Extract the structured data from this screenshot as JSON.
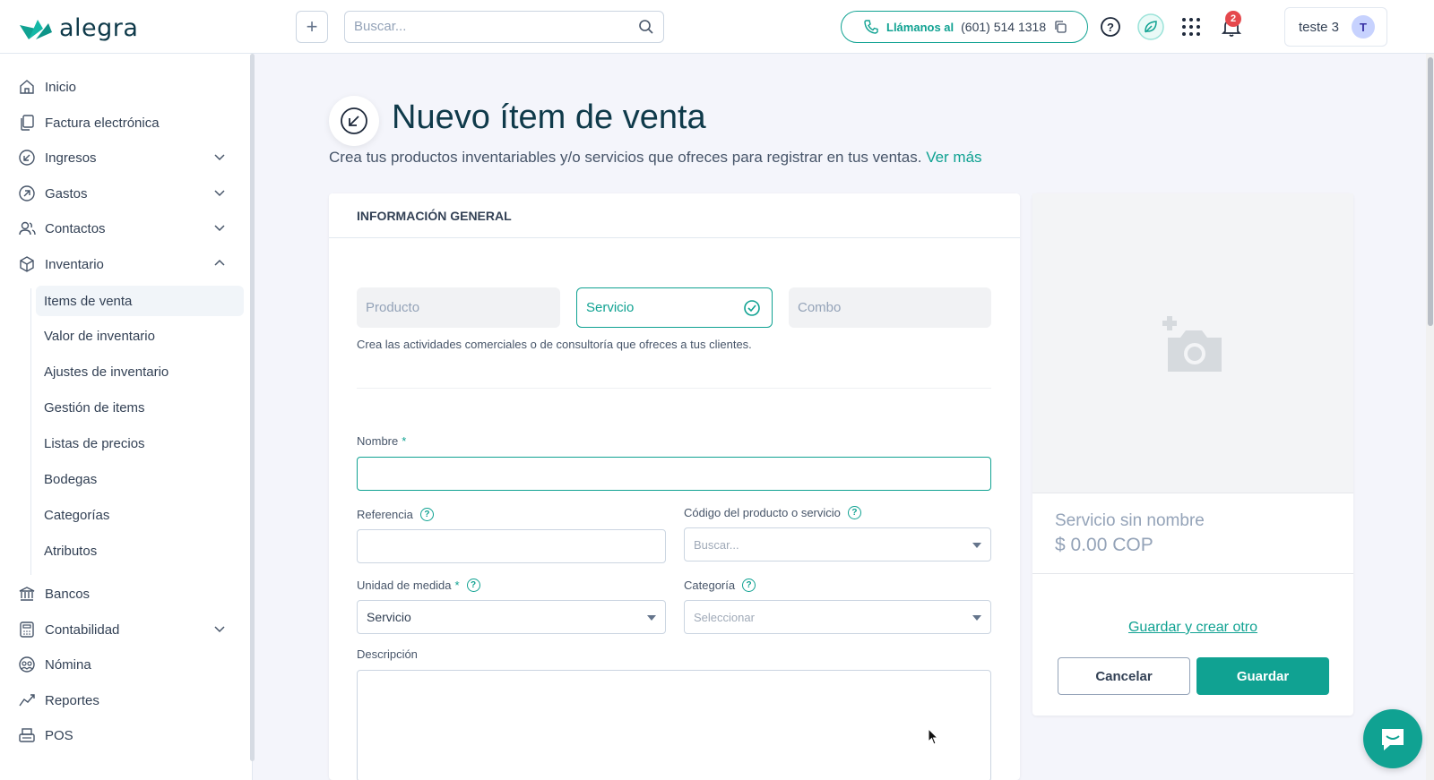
{
  "header": {
    "brand": "alegra",
    "add_label": "+",
    "search_placeholder": "Buscar...",
    "call_label": "Llámanos al",
    "call_number": "(601) 514 1318",
    "notification_count": "2",
    "user_name": "teste 3",
    "user_initial": "T"
  },
  "sidebar": {
    "items": [
      {
        "label": "Inicio"
      },
      {
        "label": "Factura electrónica"
      },
      {
        "label": "Ingresos"
      },
      {
        "label": "Gastos"
      },
      {
        "label": "Contactos"
      },
      {
        "label": "Inventario"
      },
      {
        "label": "Bancos"
      },
      {
        "label": "Contabilidad"
      },
      {
        "label": "Nómina"
      },
      {
        "label": "Reportes"
      },
      {
        "label": "POS"
      }
    ],
    "inventory_sub": [
      {
        "label": "Items de venta"
      },
      {
        "label": "Valor de inventario"
      },
      {
        "label": "Ajustes de inventario"
      },
      {
        "label": "Gestión de items"
      },
      {
        "label": "Listas de precios"
      },
      {
        "label": "Bodegas"
      },
      {
        "label": "Categorías"
      },
      {
        "label": "Atributos"
      }
    ]
  },
  "page": {
    "title": "Nuevo ítem de venta",
    "subtitle": "Crea tus productos inventariables y/o servicios que ofreces para registrar en tus ventas.",
    "subtitle_link": "Ver más"
  },
  "form": {
    "section_title": "INFORMACIÓN GENERAL",
    "types": [
      "Producto",
      "Servicio",
      "Combo"
    ],
    "selected_type": "Servicio",
    "type_help": "Crea las actividades comerciales o de consultoría que ofreces a tus clientes.",
    "name_label": "Nombre",
    "required_mark": "*",
    "name_value": "",
    "reference_label": "Referencia",
    "reference_value": "",
    "code_label": "Código del producto o servicio",
    "code_placeholder": "Buscar...",
    "unit_label": "Unidad de medida",
    "unit_value": "Servicio",
    "category_label": "Categoría",
    "category_placeholder": "Seleccionar",
    "description_label": "Descripción",
    "help_glyph": "?"
  },
  "preview": {
    "name": "Servicio sin nombre",
    "price": "$ 0.00 COP",
    "save_new_label": "Guardar y crear otro",
    "cancel_label": "Cancelar",
    "save_label": "Guardar"
  },
  "colors": {
    "accent": "#10a292",
    "title": "#0f3a4a",
    "badge": "#e5484d"
  }
}
